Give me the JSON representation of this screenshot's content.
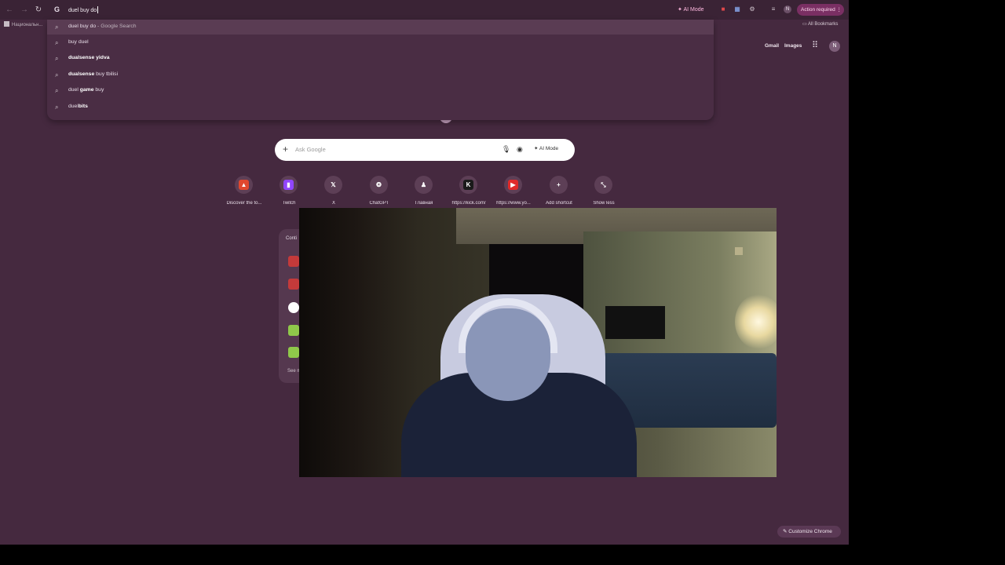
{
  "toolbar": {
    "omnibox_text": "duel buy do",
    "ai_mode_label": "AI Mode",
    "action_required_label": "Action required",
    "profile_initial": "N"
  },
  "bookmarks": {
    "first_item": "Национальн...",
    "all_bookmarks": "All Bookmarks"
  },
  "google_header": {
    "gmail": "Gmail",
    "images": "Images",
    "avatar_initial": "N"
  },
  "suggestions": [
    {
      "prefix": "duel buy do",
      "bold": "",
      "suffix": " - Google Search",
      "highlighted": true
    },
    {
      "prefix": "buy duel",
      "bold": "",
      "suffix": "",
      "highlighted": false
    },
    {
      "prefix": "",
      "bold": "dualsense yidva",
      "suffix": "",
      "highlighted": false
    },
    {
      "prefix": "",
      "bold": "dualsense",
      "suffix": " buy tbilisi",
      "highlighted": false
    },
    {
      "prefix": "duel ",
      "bold": "game",
      "suffix": " buy",
      "highlighted": false
    },
    {
      "prefix": "duel",
      "bold": "bits",
      "suffix": "",
      "highlighted": false
    }
  ],
  "searchbox": {
    "placeholder": "Ask Google",
    "ai_mode_label": "AI Mode"
  },
  "shortcuts": [
    {
      "label": "Discover the to...",
      "icon": "discover-icon",
      "color": "#e0482e",
      "glyph": "▲"
    },
    {
      "label": "Twitch",
      "icon": "twitch-icon",
      "color": "#9146ff",
      "glyph": "▮"
    },
    {
      "label": "X",
      "icon": "x-icon",
      "color": "transparent",
      "glyph": "𝕏"
    },
    {
      "label": "ChatGPT",
      "icon": "chatgpt-icon",
      "color": "transparent",
      "glyph": "❂"
    },
    {
      "label": "Главная",
      "icon": "chess-pawn-icon",
      "color": "transparent",
      "glyph": "♟"
    },
    {
      "label": "https://kick.com/",
      "icon": "kick-icon",
      "color": "#1a1a1a",
      "glyph": "K"
    },
    {
      "label": "https://www.yo...",
      "icon": "youtube-icon",
      "color": "#e02a2a",
      "glyph": "▶"
    },
    {
      "label": "Add shortcut",
      "icon": "plus-icon",
      "color": "transparent",
      "glyph": "+"
    },
    {
      "label": "Show less",
      "icon": "collapse-icon",
      "color": "transparent",
      "glyph": "⤡"
    }
  ],
  "continue_card": {
    "title": "Conti",
    "see_more": "See m"
  },
  "customize_label": "Customize Chrome",
  "colors": {
    "background": "#45293f",
    "accent": "#7a2f63",
    "dropdown": "#4a2d44"
  }
}
